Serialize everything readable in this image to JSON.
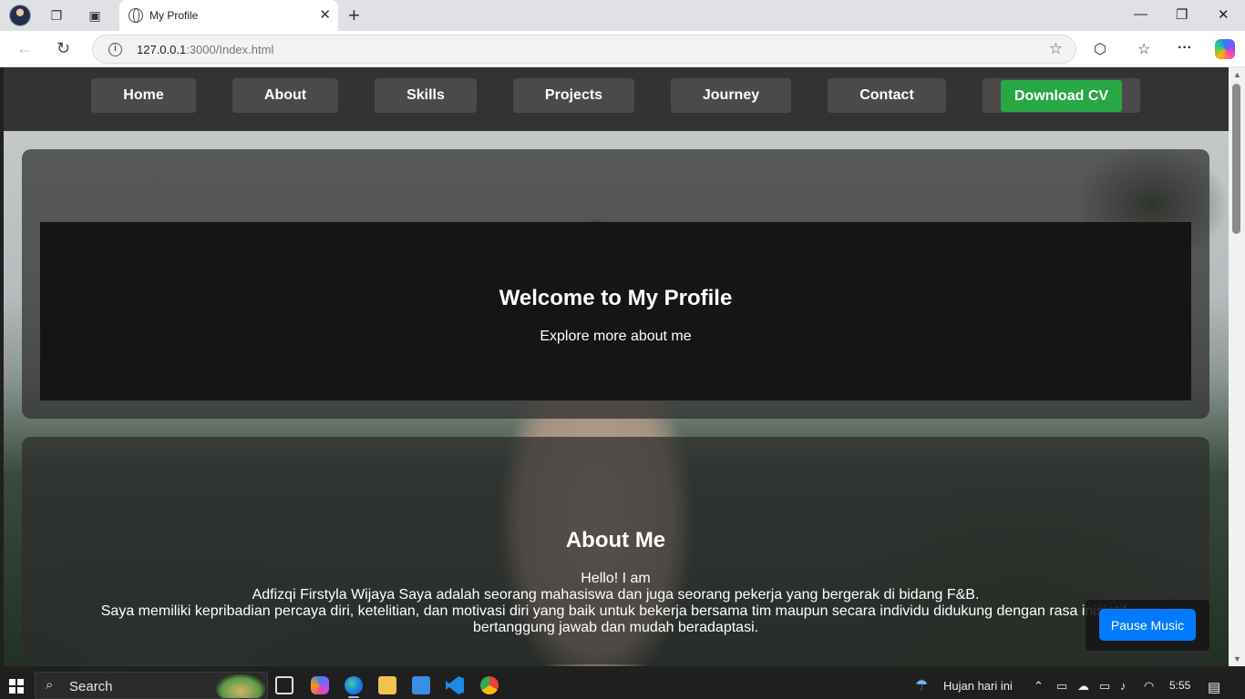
{
  "browser": {
    "tab_title": "My Profile",
    "url_host": "127.0.0.1",
    "url_rest": ":3000/Index.html"
  },
  "nav": {
    "items": [
      "Home",
      "About",
      "Skills",
      "Projects",
      "Journey",
      "Contact"
    ],
    "download_cv": "Download CV"
  },
  "hero": {
    "title": "Welcome to My Profile",
    "subtitle": "Explore more about me"
  },
  "about": {
    "title": "About Me",
    "lines": [
      "Hello! I am",
      "Adfizqi Firstyla Wijaya Saya adalah seorang mahasiswa dan juga seorang pekerja yang bergerak di bidang F&B.",
      "Saya memiliki kepribadian percaya diri, ketelitian, dan motivasi diri yang baik untuk bekerja bersama tim maupun secara individu didukung dengan rasa inisiatif,",
      "bertanggung jawab dan mudah beradaptasi."
    ]
  },
  "music": {
    "button": "Pause Music"
  },
  "taskbar": {
    "search": "Search",
    "weather": "Hujan hari ini",
    "time": "5:55"
  },
  "colors": {
    "navbar": "#333333",
    "nav_button": "#4a4a4a",
    "download_cv": "#28a745",
    "music_button": "#007bff"
  }
}
